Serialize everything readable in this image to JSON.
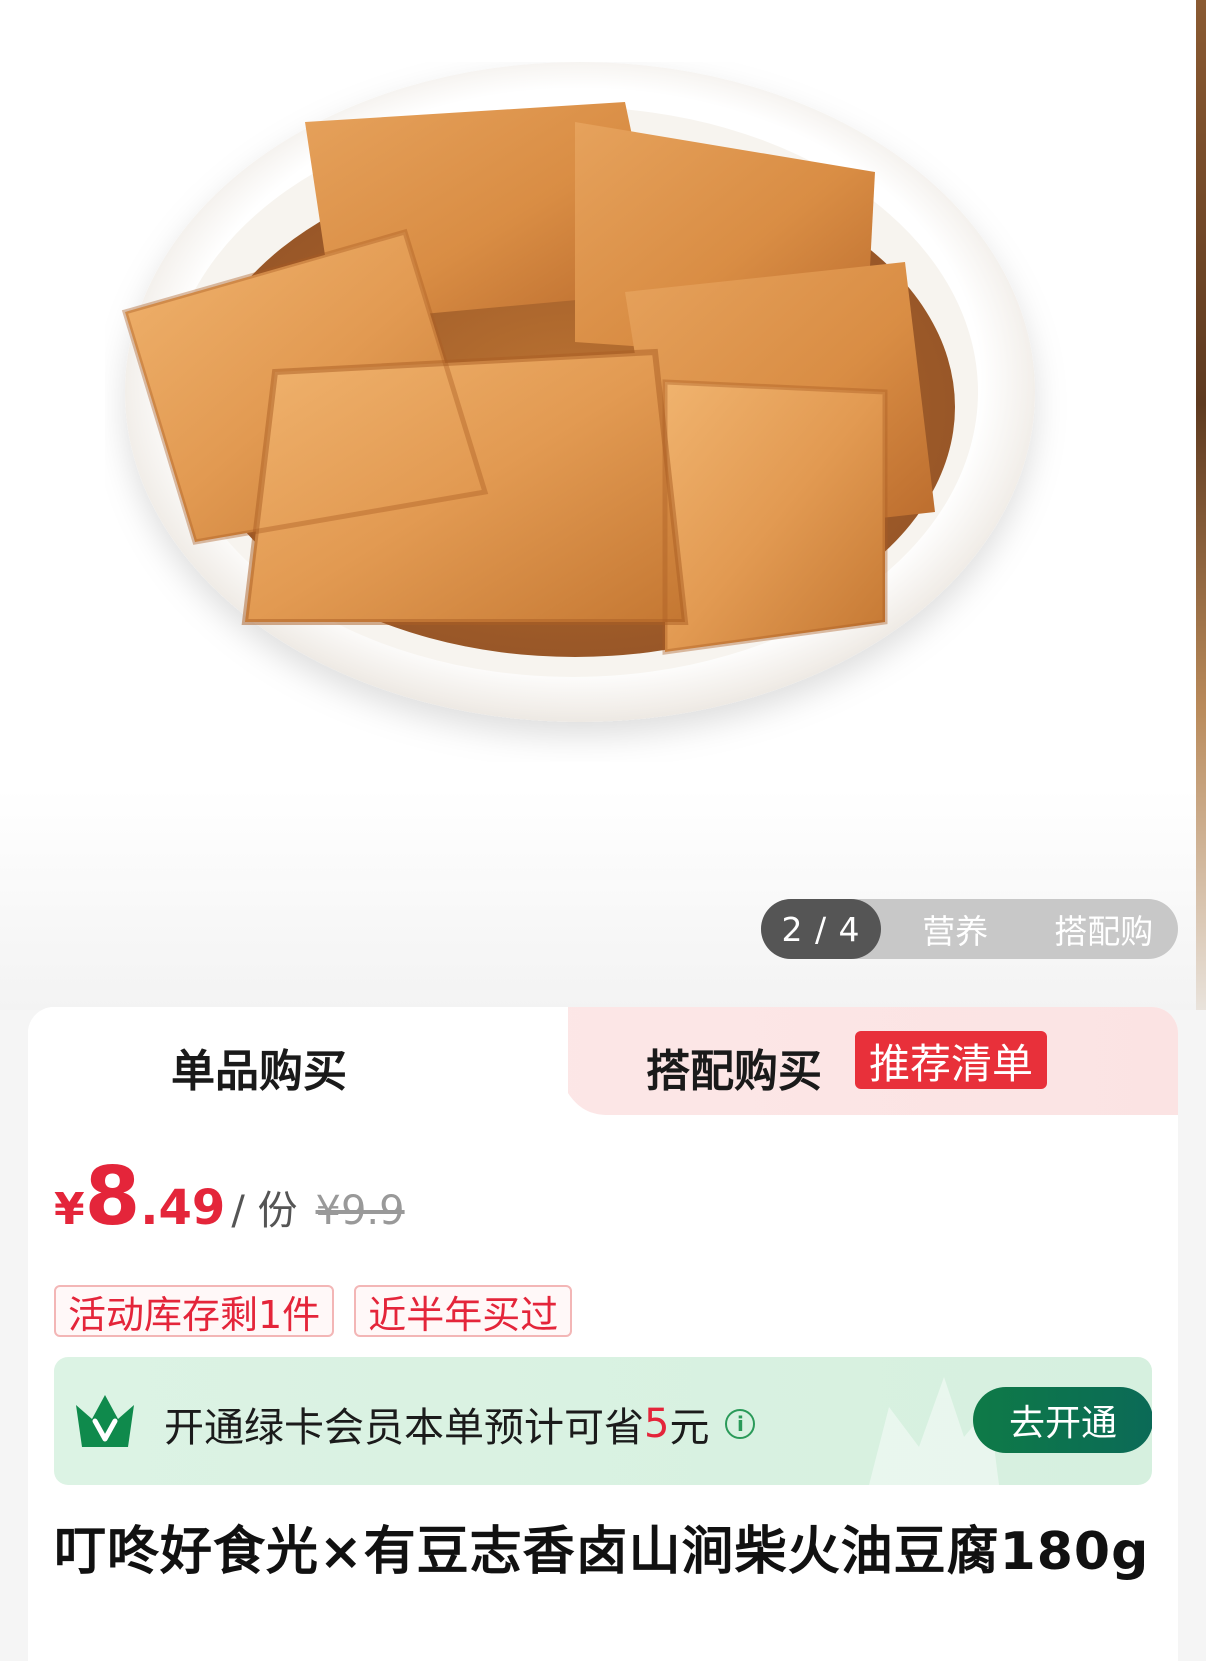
{
  "gallery": {
    "pager": "2 / 4",
    "tabs": [
      "营养",
      "搭配购"
    ]
  },
  "purchase_tabs": {
    "single": "单品购买",
    "combo": "搭配购买",
    "combo_badge": "推荐清单"
  },
  "price": {
    "currency": "¥",
    "integer": "8",
    "decimal": ".49",
    "unit": "/ 份",
    "original": "¥9.9"
  },
  "tags": [
    "活动库存剩1件",
    "近半年买过"
  ],
  "member": {
    "text_before": "开通绿卡会员本单预计可省",
    "save_amount": "5",
    "text_after": "元",
    "info_icon": "i",
    "button": "去开通"
  },
  "product": {
    "title": "叮咚好食光×有豆志香卤山涧柴火油豆腐180g"
  },
  "colors": {
    "price_red": "#e4253a",
    "member_green": "#0e7a47",
    "badge_red": "#e8303a"
  }
}
